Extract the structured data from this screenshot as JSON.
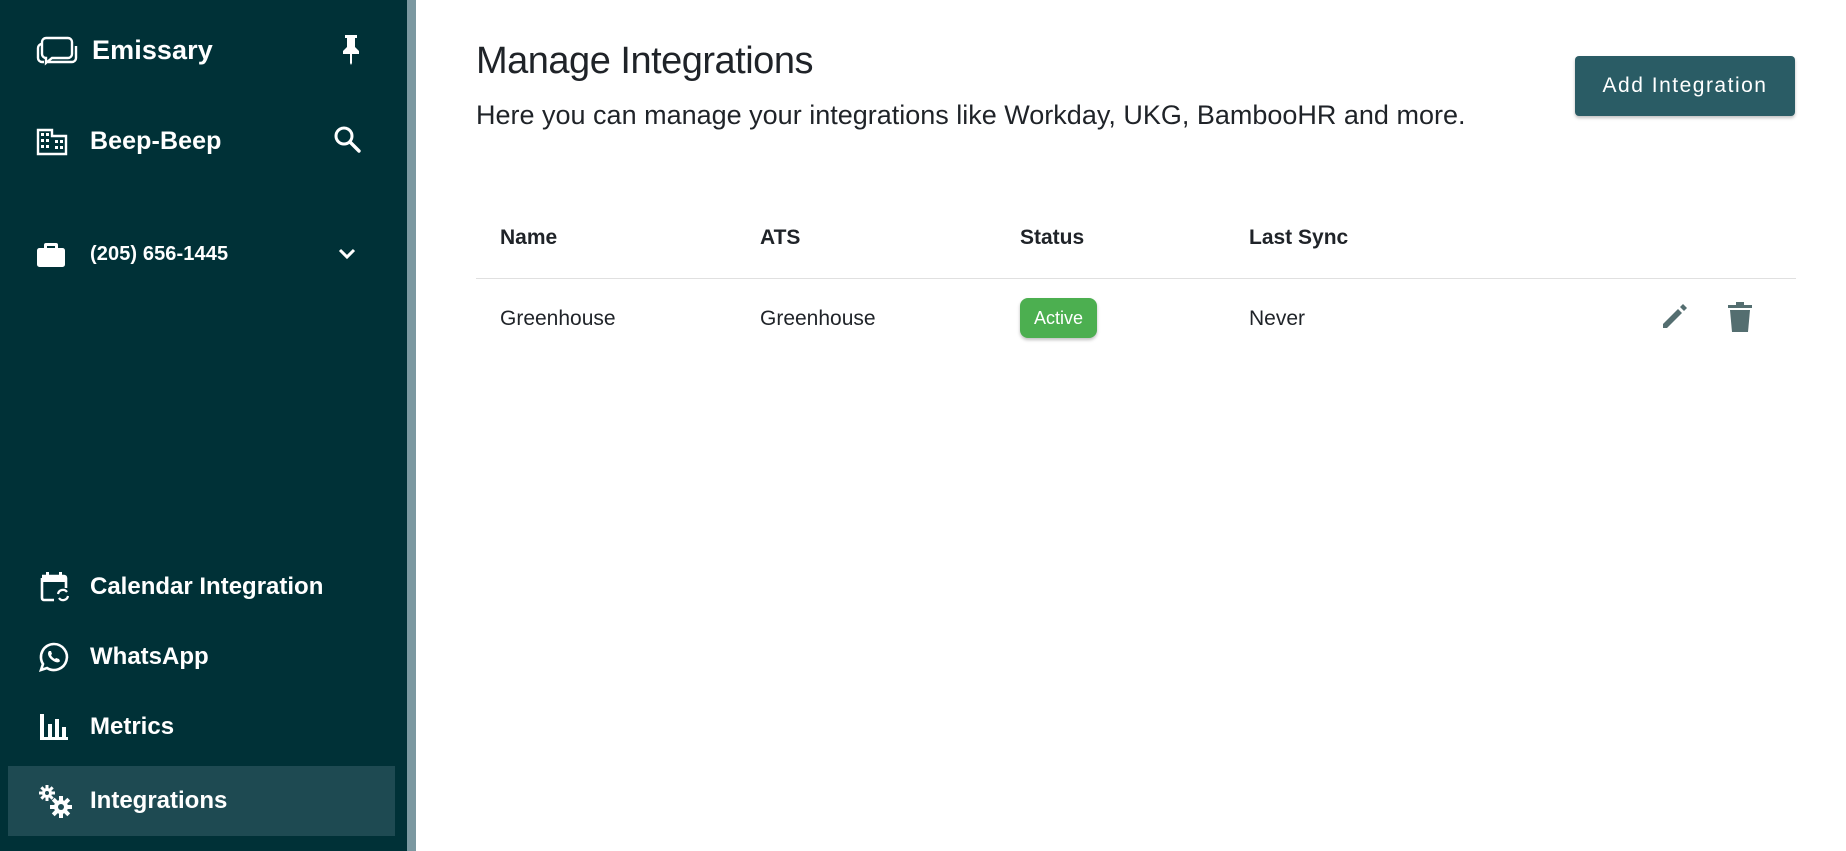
{
  "sidebar": {
    "brand": "Emissary",
    "org": "Beep-Beep",
    "phone": "(205) 656-1445",
    "nav": [
      {
        "label": "Calendar Integration"
      },
      {
        "label": "WhatsApp"
      },
      {
        "label": "Metrics"
      },
      {
        "label": "Integrations"
      }
    ]
  },
  "main": {
    "title": "Manage Integrations",
    "subtitle": "Here you can manage your integrations like Workday, UKG, BambooHR and more.",
    "add_button": "Add Integration",
    "table": {
      "headers": [
        "Name",
        "ATS",
        "Status",
        "Last Sync"
      ],
      "rows": [
        {
          "name": "Greenhouse",
          "ats": "Greenhouse",
          "status": "Active",
          "last_sync": "Never"
        }
      ]
    }
  },
  "colors": {
    "sidebar_bg": "#003137",
    "active_item_bg": "#1e4a52",
    "primary_button": "#2a5c65",
    "status_active": "#4caf50",
    "action_icon": "#546e70"
  }
}
